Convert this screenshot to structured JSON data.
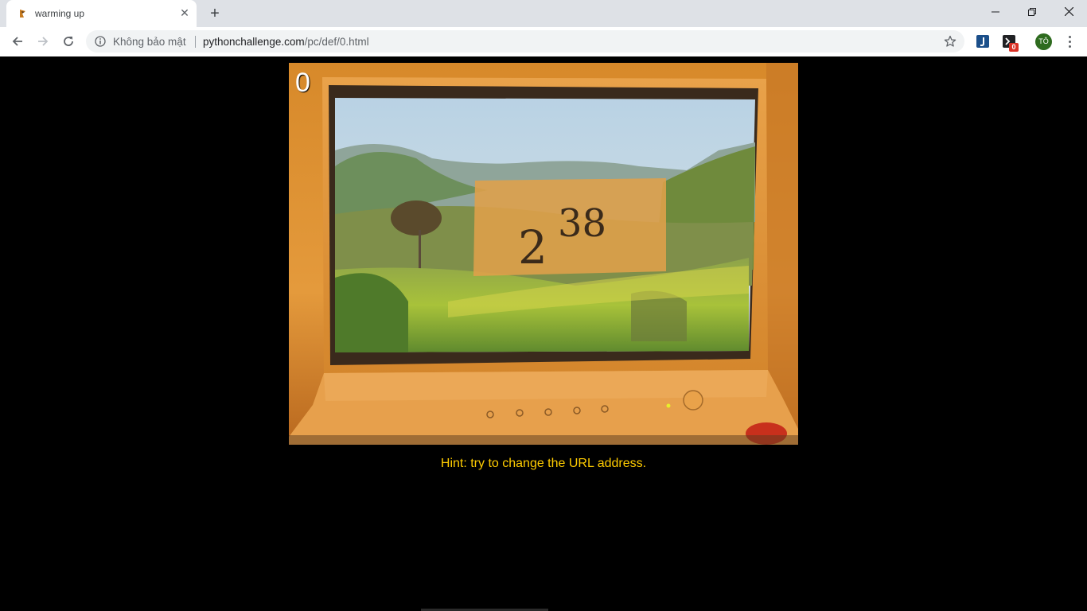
{
  "browser": {
    "tab": {
      "title": "warming up",
      "favicon": "python-challenge-favicon"
    },
    "address_bar": {
      "security_label": "Không bảo mật",
      "url_host": "pythonchallenge.com",
      "url_path": "/pc/def/0.html"
    },
    "extension_badge": "0",
    "profile_initials": "TÔ",
    "icons": [
      "back-icon",
      "forward-icon",
      "reload-icon",
      "info-icon",
      "star-icon",
      "extension-icon",
      "menu-icon"
    ]
  },
  "page": {
    "level_number": "0",
    "formula": {
      "base": "2",
      "exponent": "38"
    },
    "hint": "Hint: try to change the URL address."
  },
  "colors": {
    "hint": "#ffcc00",
    "background": "#000000",
    "monitor": "#d98a2c",
    "avatar": "#2e6b1f"
  }
}
